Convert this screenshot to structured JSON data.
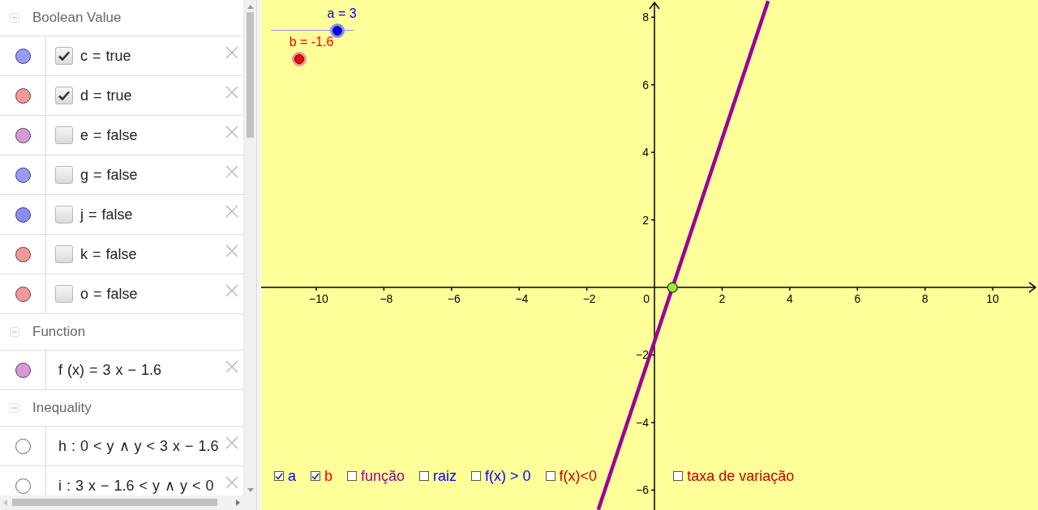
{
  "algebra_view": {
    "sections": [
      {
        "title": "Boolean Value",
        "items": [
          {
            "kind": "boolean",
            "text": "c = true",
            "checked": true,
            "color": "#9999ff"
          },
          {
            "kind": "boolean",
            "text": "d = true",
            "checked": true,
            "color": "#f29999"
          },
          {
            "kind": "boolean",
            "text": "e = false",
            "checked": false,
            "color": "#d699d6"
          },
          {
            "kind": "boolean",
            "text": "g = false",
            "checked": false,
            "color": "#9999ff"
          },
          {
            "kind": "boolean",
            "text": "j = false",
            "checked": false,
            "color": "#8c8cf5"
          },
          {
            "kind": "boolean",
            "text": "k = false",
            "checked": false,
            "color": "#f09999"
          },
          {
            "kind": "boolean",
            "text": "o = false",
            "checked": false,
            "color": "#f09999"
          }
        ]
      },
      {
        "title": "Function",
        "items": [
          {
            "kind": "expression",
            "text": "f (x) = 3 x − 1.6",
            "color": "#d699d6"
          }
        ]
      },
      {
        "title": "Inequality",
        "items": [
          {
            "kind": "expression",
            "text": "h : 0 < y ∧ y < 3 x − 1.6",
            "color": "#ffffff"
          },
          {
            "kind": "expression",
            "text": "i : 3 x − 1.6 < y ∧ y < 0",
            "color": "#ffffff"
          }
        ]
      }
    ]
  },
  "graphics_view": {
    "sliders": [
      {
        "label": "a = 3",
        "color": "#0000ff",
        "level": 0.8
      },
      {
        "label": "b = -1.6",
        "color": "#ff0000",
        "level": 0.34
      }
    ],
    "checkboxes": [
      {
        "label": "a",
        "checked": true,
        "color": "#0000ff"
      },
      {
        "label": "b",
        "checked": true,
        "color": "#ff0000"
      },
      {
        "label": "função",
        "checked": false,
        "color": "#990099"
      },
      {
        "label": "raiz",
        "checked": false,
        "color": "#0000ff"
      },
      {
        "label": "f(x) > 0",
        "checked": false,
        "color": "#0000ff"
      },
      {
        "label": "f(x)<0",
        "checked": false,
        "color": "#cc0000"
      },
      {
        "label": "taxa de variação",
        "checked": false,
        "color": "#cc0000"
      }
    ],
    "origin_label": "0",
    "chart_data": {
      "type": "line",
      "x": [
        -1.66,
        3.36
      ],
      "series": [
        {
          "color": "#990099",
          "values": [
            -6.58,
            8.48
          ]
        }
      ],
      "xlim": [
        -11.63,
        11.34
      ],
      "ylim": [
        -6.59,
        8.51
      ],
      "xticks": [
        {
          "value": -10,
          "label": "−10"
        },
        {
          "value": -8,
          "label": "−8"
        },
        {
          "value": -6,
          "label": "−6"
        },
        {
          "value": -4,
          "label": "−4"
        },
        {
          "value": -2,
          "label": "−2"
        },
        {
          "value": 2,
          "label": "2"
        },
        {
          "value": 4,
          "label": "4"
        },
        {
          "value": 6,
          "label": "6"
        },
        {
          "value": 8,
          "label": "8"
        },
        {
          "value": 10,
          "label": "10"
        }
      ],
      "yticks": [
        {
          "value": -6,
          "label": "−6"
        },
        {
          "value": -4,
          "label": "−4"
        },
        {
          "value": -2,
          "label": "−2"
        },
        {
          "value": 2,
          "label": "2"
        },
        {
          "value": 4,
          "label": "4"
        },
        {
          "value": 6,
          "label": "6"
        },
        {
          "value": 8,
          "label": "8"
        }
      ]
    }
  }
}
